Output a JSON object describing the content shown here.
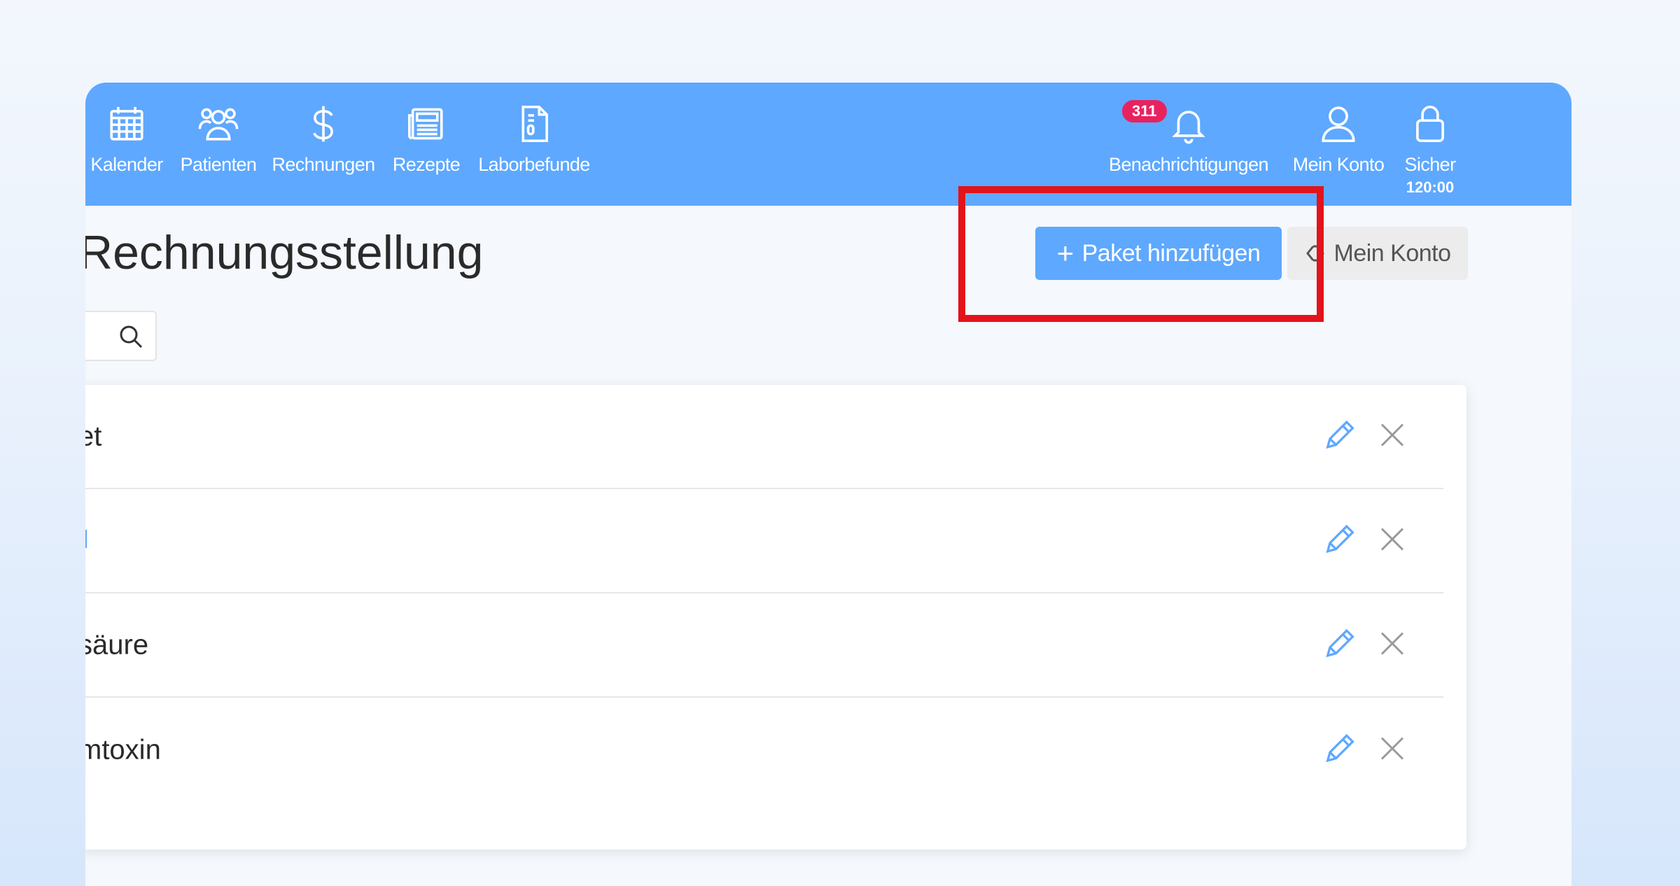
{
  "nav": {
    "items": [
      {
        "label": "Kalender",
        "icon": "calendar-icon"
      },
      {
        "label": "Patienten",
        "icon": "users-icon"
      },
      {
        "label": "Rechnungen",
        "icon": "dollar-icon"
      },
      {
        "label": "Rezepte",
        "icon": "newspaper-icon"
      },
      {
        "label": "Laborbefunde",
        "icon": "document-icon"
      }
    ],
    "notifications": {
      "label": "Benachrichtigungen",
      "badge": "311",
      "icon": "bell-icon"
    },
    "account": {
      "label": "Mein Konto",
      "icon": "user-icon"
    },
    "lock": {
      "label": "Sicher",
      "timer": "120:00",
      "icon": "lock-icon"
    }
  },
  "page": {
    "title": "Rechnungsstellung",
    "add_button": "Paket hinzufügen",
    "back_button": "Mein Konto"
  },
  "list": {
    "rows": [
      {
        "label": "et"
      },
      {
        "label": ""
      },
      {
        "label": "säure"
      },
      {
        "label": "mtoxin"
      }
    ]
  },
  "colors": {
    "nav_bg": "#5ea8ff",
    "primary": "#5ea8ff",
    "badge": "#e8225f",
    "highlight": "#e3131b"
  }
}
